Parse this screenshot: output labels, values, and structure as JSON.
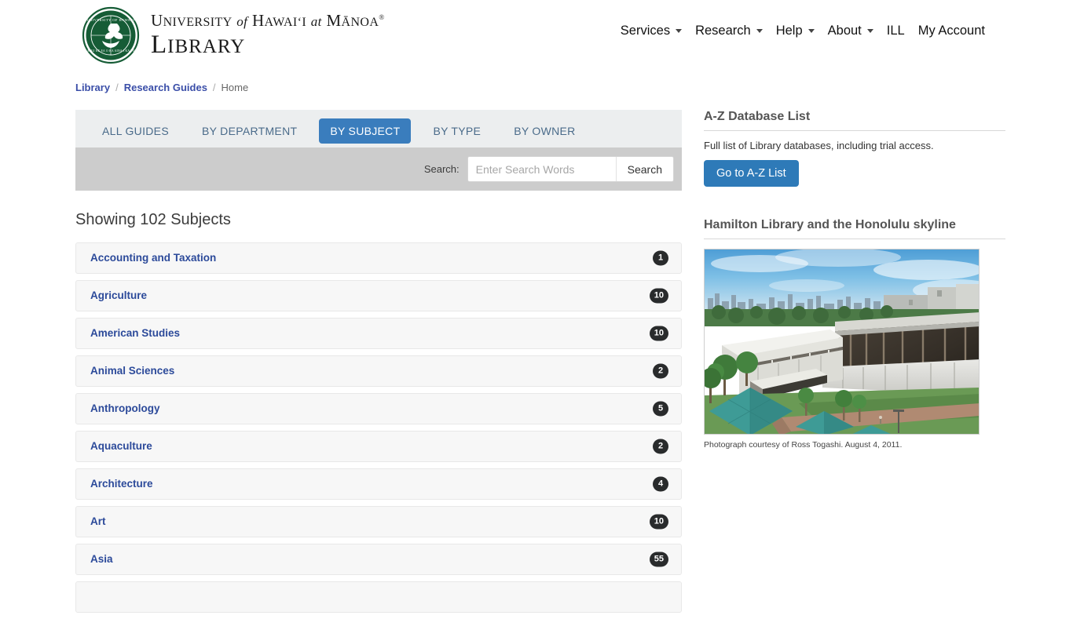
{
  "header": {
    "logo_alt": "University of Hawaii at Manoa seal",
    "wordmark_line1_a": "U",
    "wordmark_line1_b": "NIVERSITY",
    "wordmark_of": "of",
    "wordmark_line1_c": "H",
    "wordmark_line1_d": "AWAIʻI",
    "wordmark_at": "at",
    "wordmark_line1_e": "M",
    "wordmark_line1_f": "ĀNOA",
    "wordmark_reg": "®",
    "wordmark_line2_a": "L",
    "wordmark_line2_b": "IBRARY",
    "nav": [
      {
        "label": "Services",
        "has_dropdown": true
      },
      {
        "label": "Research",
        "has_dropdown": true
      },
      {
        "label": "Help",
        "has_dropdown": true
      },
      {
        "label": "About",
        "has_dropdown": true
      },
      {
        "label": "ILL",
        "has_dropdown": false
      },
      {
        "label": "My Account",
        "has_dropdown": false
      }
    ]
  },
  "breadcrumb": {
    "items": [
      {
        "label": "Library",
        "link": true
      },
      {
        "label": "Research Guides",
        "link": true
      },
      {
        "label": "Home",
        "link": false
      }
    ],
    "separator": "/"
  },
  "tabs": [
    {
      "label": "ALL GUIDES",
      "active": false
    },
    {
      "label": "BY DEPARTMENT",
      "active": false
    },
    {
      "label": "BY SUBJECT",
      "active": true
    },
    {
      "label": "BY TYPE",
      "active": false
    },
    {
      "label": "BY OWNER",
      "active": false
    }
  ],
  "search": {
    "label": "Search:",
    "placeholder": "Enter Search Words",
    "value": "",
    "button_label": "Search"
  },
  "results": {
    "showing_text": "Showing 102 Subjects",
    "count": 102,
    "subjects": [
      {
        "name": "Accounting and Taxation",
        "count": "1"
      },
      {
        "name": "Agriculture",
        "count": "10"
      },
      {
        "name": "American Studies",
        "count": "10"
      },
      {
        "name": "Animal Sciences",
        "count": "2"
      },
      {
        "name": "Anthropology",
        "count": "5"
      },
      {
        "name": "Aquaculture",
        "count": "2"
      },
      {
        "name": "Architecture",
        "count": "4"
      },
      {
        "name": "Art",
        "count": "10"
      },
      {
        "name": "Asia",
        "count": "55"
      }
    ]
  },
  "sidebar": {
    "database_box": {
      "title": "A-Z Database List",
      "description": "Full list of Library databases, including trial access.",
      "button_label": "Go to A-Z List"
    },
    "photo_box": {
      "title": "Hamilton Library and the Honolulu skyline",
      "caption": "Photograph courtesy of Ross Togashi. August 4, 2011."
    }
  },
  "colors": {
    "accent_blue": "#3a7dbd",
    "button_blue": "#2e7ab8",
    "link_blue": "#2c4a9a",
    "badge_dark": "#292b2c",
    "tabbar_bg": "#eceeef",
    "searchbar_bg": "#cccccc",
    "row_bg": "#f7f7f7",
    "seal_green": "#165c36"
  }
}
